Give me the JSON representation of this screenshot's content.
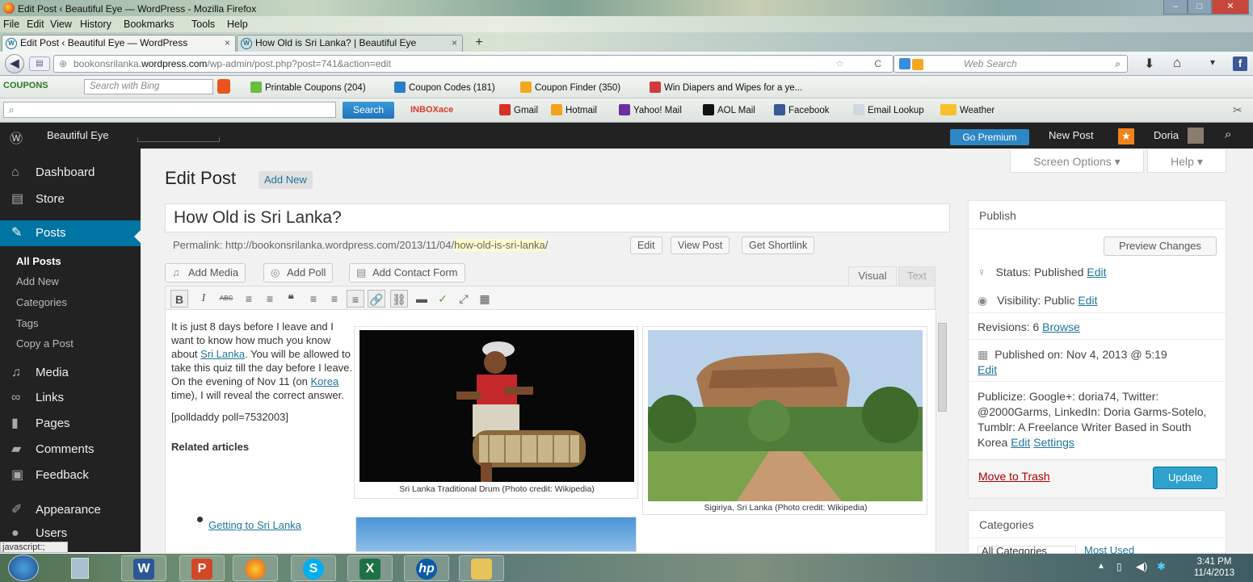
{
  "window": {
    "title": "Edit Post ‹ Beautiful Eye — WordPress - Mozilla Firefox",
    "menu": [
      "File",
      "Edit",
      "View",
      "History",
      "Bookmarks",
      "Tools",
      "Help"
    ]
  },
  "tabs": [
    {
      "label": "Edit Post ‹ Beautiful Eye — WordPress",
      "close": "×"
    },
    {
      "label": "How Old is Sri Lanka? | Beautiful Eye",
      "close": "×"
    }
  ],
  "new_tab": "+",
  "address": {
    "url_prefix": "bookonsrilanka.",
    "url_domain": "wordpress.com",
    "url_path": "/wp-admin/post.php?post=741&action=edit",
    "search_placeholder": "Web Search"
  },
  "bookmarks1": {
    "coupons": "COUPONS",
    "search_placeholder": "Search with Bing",
    "items": [
      "Printable Coupons (204)",
      "Coupon Codes (181)",
      "Coupon Finder (350)",
      "Win Diapers and Wipes for a ye..."
    ]
  },
  "bookmarks2": {
    "search_button": "Search",
    "inboxace": "INBOXace",
    "items": [
      "Gmail",
      "Hotmail",
      "Yahoo! Mail",
      "AOL Mail",
      "Facebook",
      "Email Lookup",
      "Weather"
    ]
  },
  "adminbar": {
    "site": "Beautiful Eye",
    "go_premium": "Go Premium",
    "new_post": "New Post",
    "user": "Doria"
  },
  "sidebar": {
    "dashboard": "Dashboard",
    "store": "Store",
    "posts": "Posts",
    "posts_sub": [
      "All Posts",
      "Add New",
      "Categories",
      "Tags",
      "Copy a Post"
    ],
    "media": "Media",
    "links": "Links",
    "pages": "Pages",
    "comments": "Comments",
    "feedback": "Feedback",
    "appearance": "Appearance",
    "users": "Users"
  },
  "main": {
    "page_title": "Edit Post",
    "add_new": "Add New",
    "screen_options": "Screen Options ▾",
    "help": "Help ▾",
    "post_title": "How Old is Sri Lanka?",
    "permalink_label": "Permalink:",
    "permalink_base": "http://bookonsrilanka.wordpress.com/2013/11/04/",
    "permalink_slug": "how-old-is-sri-lanka",
    "permalink_end": "/",
    "edit_btn": "Edit",
    "view_post_btn": "View Post",
    "shortlink_btn": "Get Shortlink",
    "add_media": "Add Media",
    "add_poll": "Add Poll",
    "add_contact_form": "Add Contact Form",
    "tab_visual": "Visual",
    "tab_text": "Text",
    "toolbar": [
      "B",
      "I",
      "ABC",
      "≡",
      "≡",
      "❝",
      "≡",
      "≡",
      "≡",
      "🔗",
      "⛓",
      "▬",
      "✓",
      "⤢",
      "▦"
    ],
    "body_p1_a": "It is just 8 days before I leave and I want to know how much you know about ",
    "body_link1": "Sri Lanka",
    "body_p1_b": ".  You will be allowed to take this quiz till the day before I leave.  On the evening of Nov 11 (on ",
    "body_link2": "Korea",
    "body_p1_c": " time), I will reveal the correct answer.",
    "body_poll": "[polldaddy poll=7532003]",
    "related": "Related articles",
    "related_link": "Getting to Sri Lanka",
    "caption1": "Sri Lanka Traditional Drum (Photo credit: Wikipedia)",
    "caption2": "Sigiriya, Sri Lanka (Photo credit: Wikipedia)"
  },
  "publish": {
    "heading": "Publish",
    "preview": "Preview Changes",
    "status_label": "Status: ",
    "status_value": "Published",
    "visibility_label": "Visibility: ",
    "visibility_value": "Public",
    "edit": "Edit",
    "revisions_label": "Revisions: 6 ",
    "browse": "Browse",
    "published_on_label": "Published on: ",
    "published_on_value": "Nov 4, 2013 @ 5:19",
    "publicize_label": "Publicize: ",
    "publicize_value": "Google+: doria74, Twitter: @2000Garms, LinkedIn: Doria Garms-Sotelo, Tumblr: A Freelance Writer Based in South Korea",
    "settings": "Settings",
    "trash": "Move to Trash",
    "update": "Update"
  },
  "categories": {
    "heading": "Categories",
    "tab_all": "All Categories",
    "tab_most": "Most Used"
  },
  "status_bar": "javascript:;",
  "clock": {
    "time": "3:41 PM",
    "date": "11/4/2013"
  }
}
